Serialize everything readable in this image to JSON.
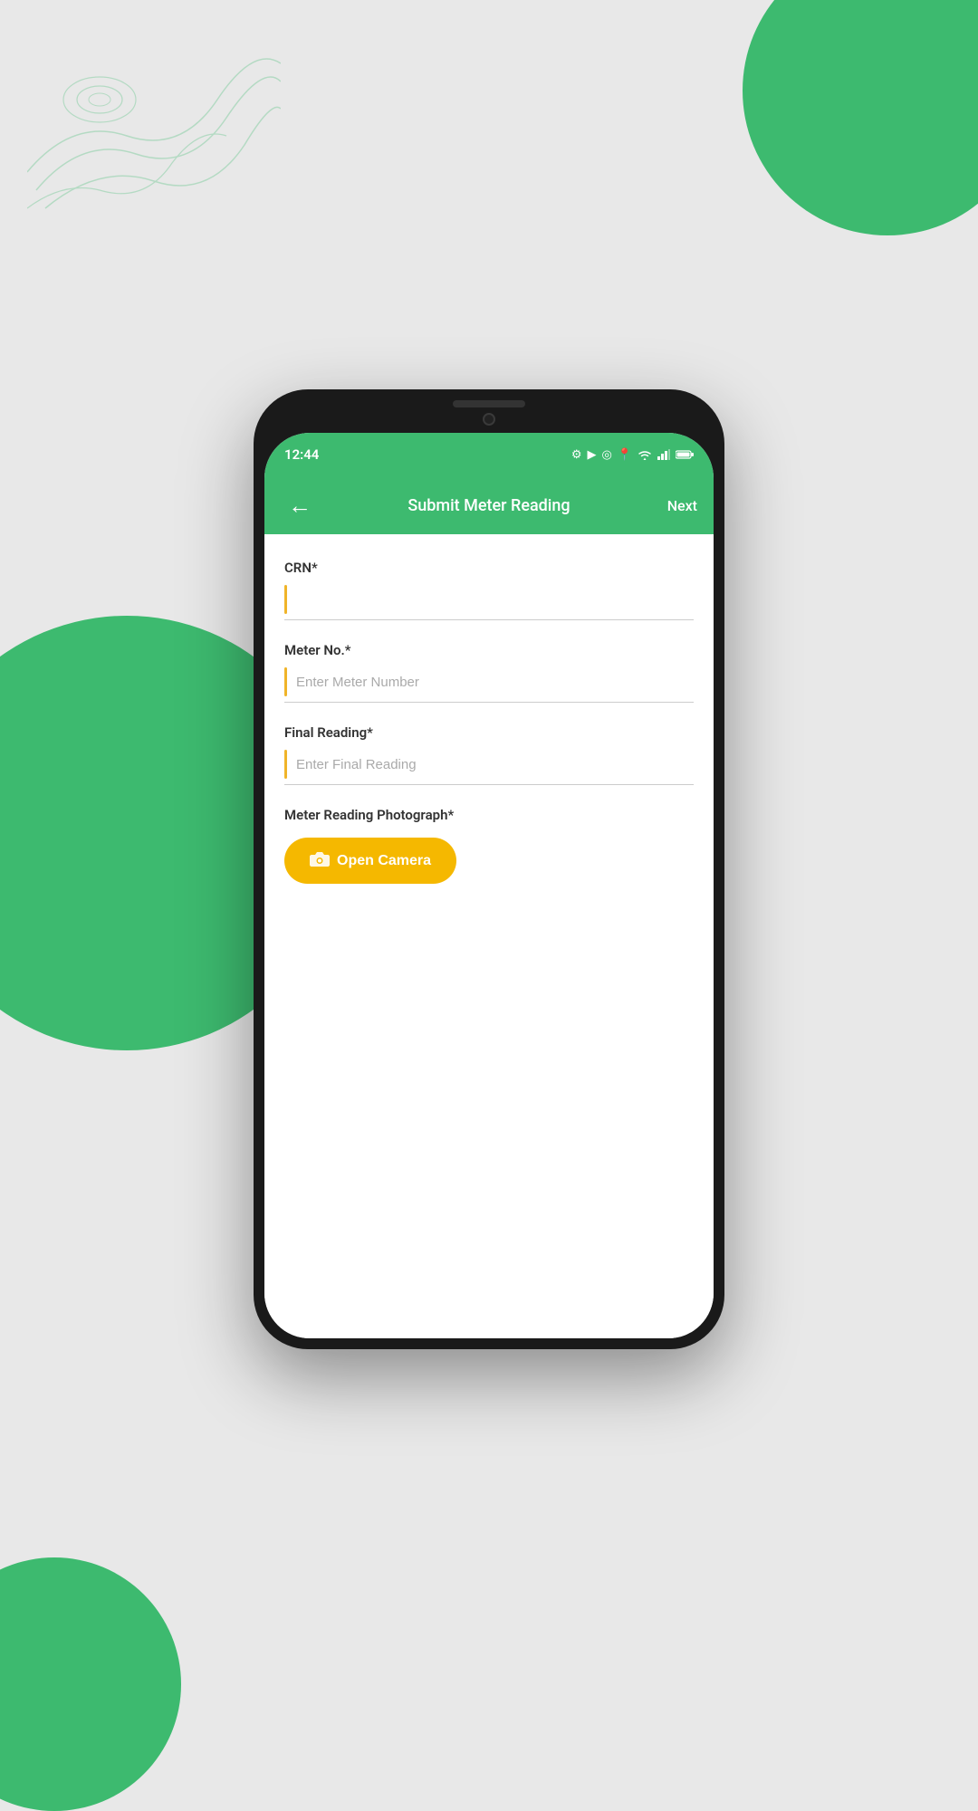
{
  "background": {
    "color": "#e8e8e8",
    "accent_color": "#3dba6f"
  },
  "status_bar": {
    "time": "12:44",
    "icons": [
      "settings",
      "play",
      "signal-circle",
      "location",
      "wifi",
      "signal-bars",
      "battery"
    ]
  },
  "app_bar": {
    "title": "Submit Meter Reading",
    "back_icon": "←",
    "next_label": "Next"
  },
  "form": {
    "fields": [
      {
        "id": "crn",
        "label": "CRN*",
        "placeholder": "",
        "value": ""
      },
      {
        "id": "meter_no",
        "label": "Meter No.*",
        "placeholder": "Enter Meter Number",
        "value": ""
      },
      {
        "id": "final_reading",
        "label": "Final Reading*",
        "placeholder": "Enter Final Reading",
        "value": ""
      }
    ],
    "photo_section": {
      "label": "Meter Reading Photograph*",
      "button_label": "Open Camera",
      "camera_icon": "📷"
    }
  }
}
